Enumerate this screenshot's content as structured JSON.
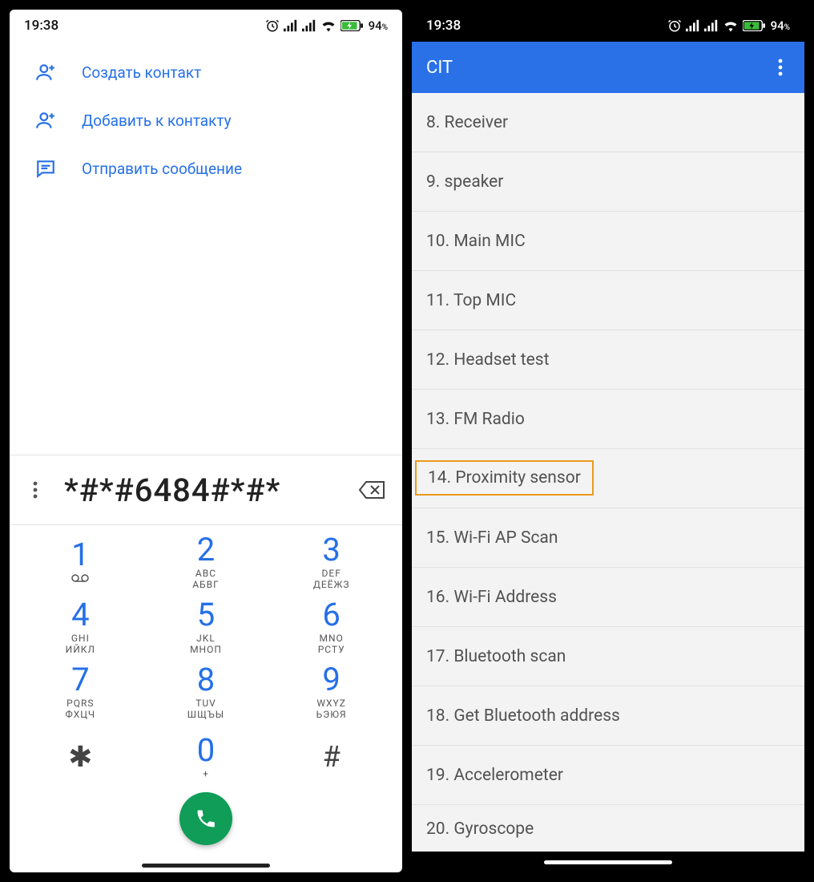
{
  "statusbar": {
    "time": "19:38",
    "battery_text": "94",
    "battery_suffix": "%"
  },
  "dialer": {
    "actions": {
      "create": "Создать контакт",
      "add": "Добавить к контакту",
      "message": "Отправить сообщение"
    },
    "entered_number": "*#*#6484#*#*",
    "keypad": [
      {
        "digit": "1",
        "sub1": "",
        "sub2": "",
        "vm": "⌕"
      },
      {
        "digit": "2",
        "sub1": "ABC",
        "sub2": "АБВГ"
      },
      {
        "digit": "3",
        "sub1": "DEF",
        "sub2": "ДЕЁЖЗ"
      },
      {
        "digit": "4",
        "sub1": "GHI",
        "sub2": "ИЙКЛ"
      },
      {
        "digit": "5",
        "sub1": "JKL",
        "sub2": "МНОП"
      },
      {
        "digit": "6",
        "sub1": "MNO",
        "sub2": "РСТУ"
      },
      {
        "digit": "7",
        "sub1": "PQRS",
        "sub2": "ФХЦЧ"
      },
      {
        "digit": "8",
        "sub1": "TUV",
        "sub2": "ШЩЪЫ"
      },
      {
        "digit": "9",
        "sub1": "WXYZ",
        "sub2": "ЬЭЮЯ"
      },
      {
        "digit": "✱",
        "sub1": "",
        "sub2": "",
        "sym": true
      },
      {
        "digit": "0",
        "sub1": "+",
        "sub2": ""
      },
      {
        "digit": "#",
        "sub1": "",
        "sub2": "",
        "sym": true
      }
    ]
  },
  "cit": {
    "title": "CIT",
    "items": [
      {
        "label": "8. Receiver",
        "highlight": false
      },
      {
        "label": "9. speaker",
        "highlight": false
      },
      {
        "label": "10. Main MIC",
        "highlight": false
      },
      {
        "label": "11. Top MIC",
        "highlight": false
      },
      {
        "label": "12. Headset test",
        "highlight": false
      },
      {
        "label": "13. FM Radio",
        "highlight": false
      },
      {
        "label": "14. Proximity sensor",
        "highlight": true
      },
      {
        "label": "15. Wi-Fi AP Scan",
        "highlight": false
      },
      {
        "label": "16. Wi-Fi Address",
        "highlight": false
      },
      {
        "label": "17. Bluetooth scan",
        "highlight": false
      },
      {
        "label": "18. Get Bluetooth address",
        "highlight": false
      },
      {
        "label": "19. Accelerometer",
        "highlight": false
      },
      {
        "label": "20. Gyroscope",
        "highlight": false
      }
    ]
  }
}
